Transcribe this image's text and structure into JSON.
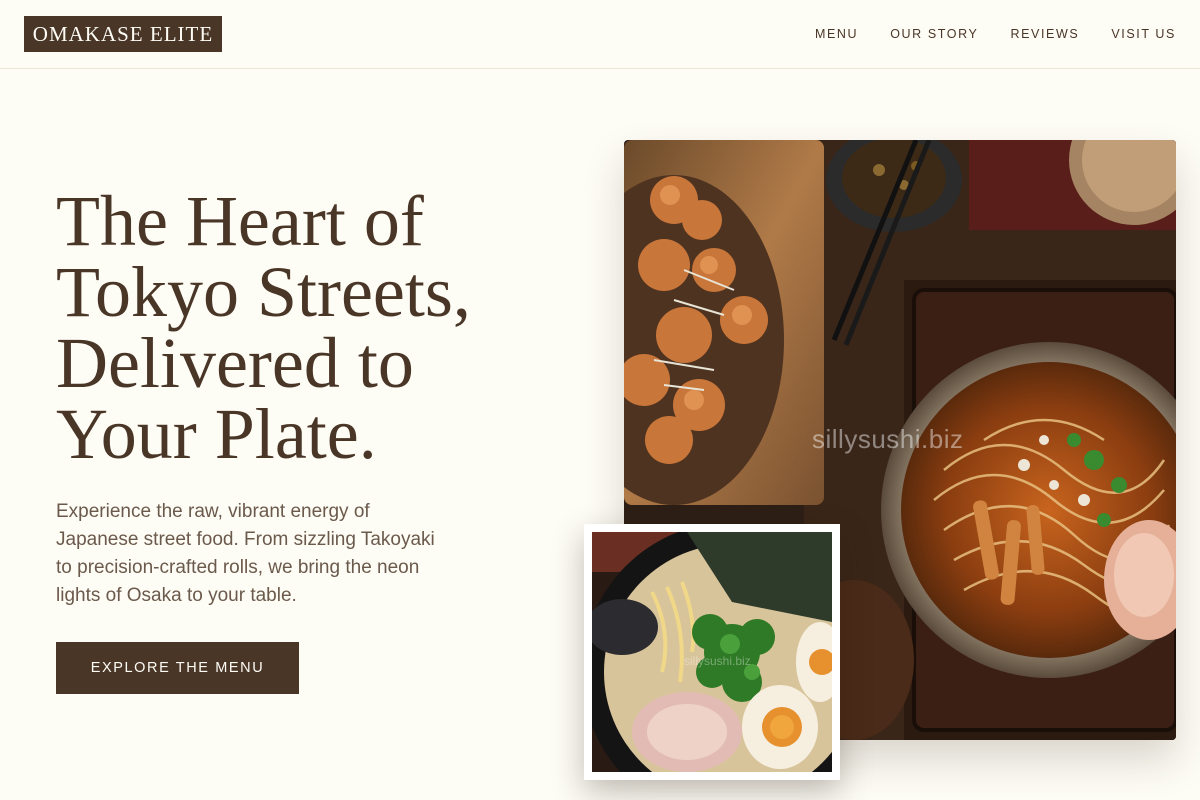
{
  "brand": {
    "name": "OMAKASE ELITE"
  },
  "nav": {
    "items": [
      {
        "label": "MENU"
      },
      {
        "label": "OUR STORY"
      },
      {
        "label": "REVIEWS"
      },
      {
        "label": "VISIT US"
      }
    ]
  },
  "hero": {
    "title_lines": [
      "The Heart of",
      "Tokyo Streets,",
      "Delivered to",
      "Your Plate."
    ],
    "description_lines": [
      "Experience the raw, vibrant energy of",
      "Japanese street food. From sizzling Takoyaki",
      "to precision-crafted rolls, we bring the neon",
      "lights of Osaka to your table."
    ],
    "cta_label": "EXPLORE THE MENU"
  },
  "images": {
    "main_watermark": "sillysushi.biz",
    "inset_watermark": "sillysushi.biz"
  },
  "colors": {
    "background": "#fdfcf5",
    "brand_brown": "#4a3627",
    "body_text": "#6b5a4c"
  }
}
